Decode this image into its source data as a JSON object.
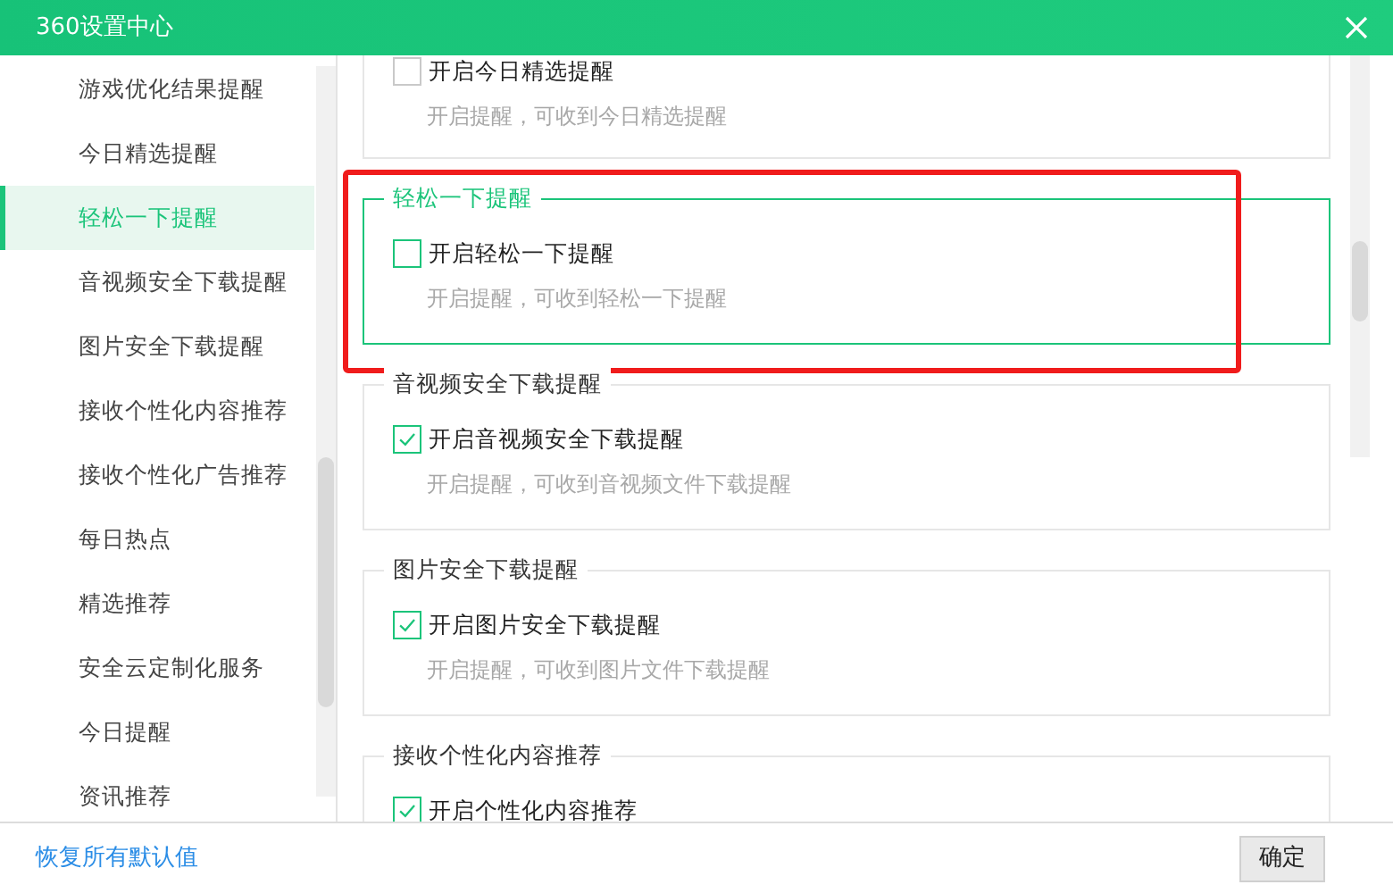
{
  "window": {
    "title": "360设置中心"
  },
  "sidebar": {
    "items": [
      {
        "label": "游戏优化结果提醒",
        "selected": false
      },
      {
        "label": "今日精选提醒",
        "selected": false
      },
      {
        "label": "轻松一下提醒",
        "selected": true
      },
      {
        "label": "音视频安全下载提醒",
        "selected": false
      },
      {
        "label": "图片安全下载提醒",
        "selected": false
      },
      {
        "label": "接收个性化内容推荐",
        "selected": false
      },
      {
        "label": "接收个性化广告推荐",
        "selected": false
      },
      {
        "label": "每日热点",
        "selected": false
      },
      {
        "label": "精选推荐",
        "selected": false
      },
      {
        "label": "安全云定制化服务",
        "selected": false
      },
      {
        "label": "今日提醒",
        "selected": false
      },
      {
        "label": "资讯推荐",
        "selected": false
      }
    ]
  },
  "sections": [
    {
      "option": "开启今日精选提醒",
      "checked": false,
      "description": "开启提醒，可收到今日精选提醒",
      "selected": false
    },
    {
      "title": "轻松一下提醒",
      "option": "开启轻松一下提醒",
      "checked": false,
      "description": "开启提醒，可收到轻松一下提醒",
      "selected": true
    },
    {
      "title": "音视频安全下载提醒",
      "option": "开启音视频安全下载提醒",
      "checked": true,
      "description": "开启提醒，可收到音视频文件下载提醒",
      "selected": false
    },
    {
      "title": "图片安全下载提醒",
      "option": "开启图片安全下载提醒",
      "checked": true,
      "description": "开启提醒，可收到图片文件下载提醒",
      "selected": false
    },
    {
      "title": "接收个性化内容推荐",
      "option": "开启个性化内容推荐",
      "checked": true,
      "selected": false
    }
  ],
  "footer": {
    "restore_link": "恢复所有默认值",
    "confirm_button": "确定"
  }
}
